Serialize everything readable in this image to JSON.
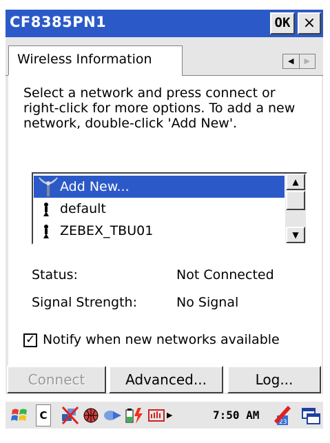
{
  "window": {
    "title": "CF8385PN1",
    "ok_label": "OK",
    "close_label": "×"
  },
  "tab": {
    "label": "Wireless Information"
  },
  "description": "Select a network and press connect or right-click for more options.  To add a new network, double-click 'Add New'.",
  "networks": [
    {
      "label": "Add New...",
      "icon": "antenna-icon",
      "selected": true
    },
    {
      "label": "default",
      "icon": "access-point-icon",
      "selected": false
    },
    {
      "label": "ZEBEX_TBU01",
      "icon": "access-point-icon",
      "selected": false
    }
  ],
  "status": {
    "label": "Status:",
    "value": "Not Connected"
  },
  "signal": {
    "label": "Signal Strength:",
    "value": "No Signal"
  },
  "notify": {
    "label": "Notify when new networks available",
    "checked": true
  },
  "buttons": {
    "connect": "Connect",
    "advanced": "Advanced...",
    "log": "Log..."
  },
  "taskbar": {
    "input_mode": "C",
    "time": "7:50 AM"
  },
  "colors": {
    "title_bar": "#2b5ac8",
    "selection": "#2b5ac8",
    "button_face": "#e6e6e6"
  }
}
